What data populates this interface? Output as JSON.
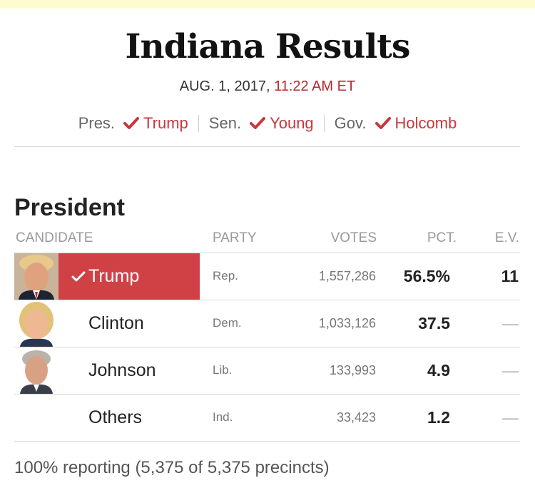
{
  "header": {
    "title": "Indiana Results",
    "date": "AUG. 1, 2017,",
    "time": "11:22 AM ET"
  },
  "summary": [
    {
      "label": "Pres.",
      "winner": "Trump"
    },
    {
      "label": "Sen.",
      "winner": "Young"
    },
    {
      "label": "Gov.",
      "winner": "Holcomb"
    }
  ],
  "section": {
    "title": "President",
    "columns": {
      "candidate": "CANDIDATE",
      "party": "PARTY",
      "votes": "VOTES",
      "pct": "PCT.",
      "ev": "E.V."
    }
  },
  "candidates": [
    {
      "name": "Trump",
      "party": "Rep.",
      "votes": "1,557,286",
      "pct": "56.5%",
      "ev": "11",
      "winner": true
    },
    {
      "name": "Clinton",
      "party": "Dem.",
      "votes": "1,033,126",
      "pct": "37.5",
      "ev": "—",
      "winner": false
    },
    {
      "name": "Johnson",
      "party": "Lib.",
      "votes": "133,993",
      "pct": "4.9",
      "ev": "—",
      "winner": false
    },
    {
      "name": "Others",
      "party": "Ind.",
      "votes": "33,423",
      "pct": "1.2",
      "ev": "—",
      "winner": false
    }
  ],
  "footer": {
    "reporting": "100% reporting (5,375 of 5,375 precincts)"
  },
  "colors": {
    "accent": "#c8373c",
    "winner_bg": "#d04146",
    "time": "#b8282c",
    "banner": "#fdfbd0"
  }
}
